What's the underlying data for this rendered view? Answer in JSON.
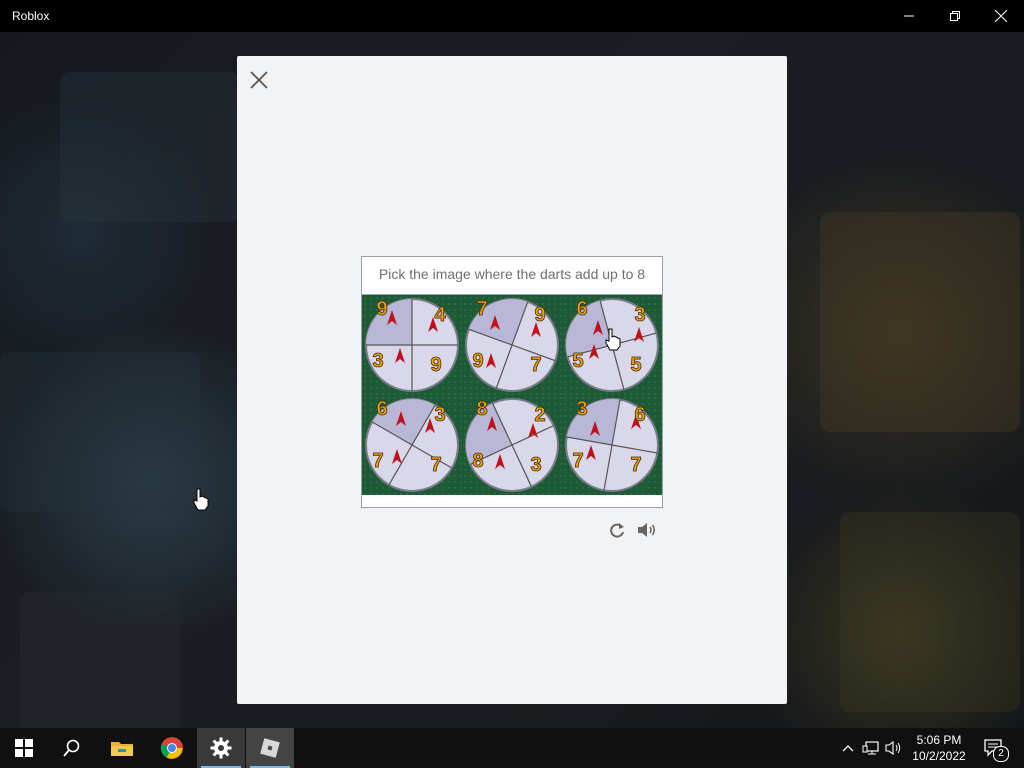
{
  "window": {
    "title": "Roblox"
  },
  "captcha": {
    "prompt": "Pick the image where the darts add up to 8",
    "refresh_icon": "refresh-icon",
    "audio_icon": "speaker-icon",
    "tiles": [
      {
        "numbers": [
          "9",
          "4",
          "3",
          "9"
        ]
      },
      {
        "numbers": [
          "7",
          "9",
          "9",
          "7"
        ]
      },
      {
        "numbers": [
          "6",
          "3",
          "5",
          "5"
        ]
      },
      {
        "numbers": [
          "6",
          "3",
          "7",
          "7"
        ]
      },
      {
        "numbers": [
          "8",
          "2",
          "8",
          "3"
        ]
      },
      {
        "numbers": [
          "3",
          "6",
          "7",
          "7"
        ]
      }
    ]
  },
  "taskbar": {
    "items": [
      "windows-start-icon",
      "search-icon",
      "file-explorer-icon",
      "chrome-icon",
      "settings-gear-icon",
      "roblox-icon"
    ],
    "time": "5:06 PM",
    "date": "10/2/2022",
    "notification_count": "2"
  },
  "colors": {
    "accent": "#76b9ed",
    "tile_green": "#1f5a36",
    "number_gold": "#e8a317",
    "dart_red": "#c0101a"
  }
}
